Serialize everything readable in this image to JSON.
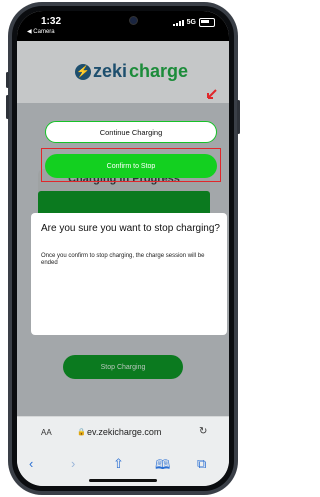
{
  "status_bar": {
    "time": "1:32",
    "back_app": "◀ Camera",
    "network": "5G"
  },
  "logo": {
    "icon_glyph": "⚡",
    "zeki": "zeki",
    "charge": "charge",
    "colors": {
      "zeki": "#1e4f6e",
      "charge": "#1c8c3a"
    }
  },
  "page": {
    "card_title": "Charging in Progress",
    "stop_button": "Stop Charging"
  },
  "modal": {
    "title": "Are you sure you want to stop charging?",
    "body": "Once you confirm to stop charging, the charge session will be ended",
    "continue_button": "Continue Charging",
    "confirm_button": "Confirm to Stop",
    "accent_color": "#13d020"
  },
  "browser": {
    "text_size_label": "AA",
    "lock_icon": "🔒",
    "url": "ev.zekicharge.com",
    "reload_icon": "↻",
    "toolbar_icons": [
      "‹",
      "›",
      "⇧",
      "🕮",
      "⧉"
    ]
  }
}
